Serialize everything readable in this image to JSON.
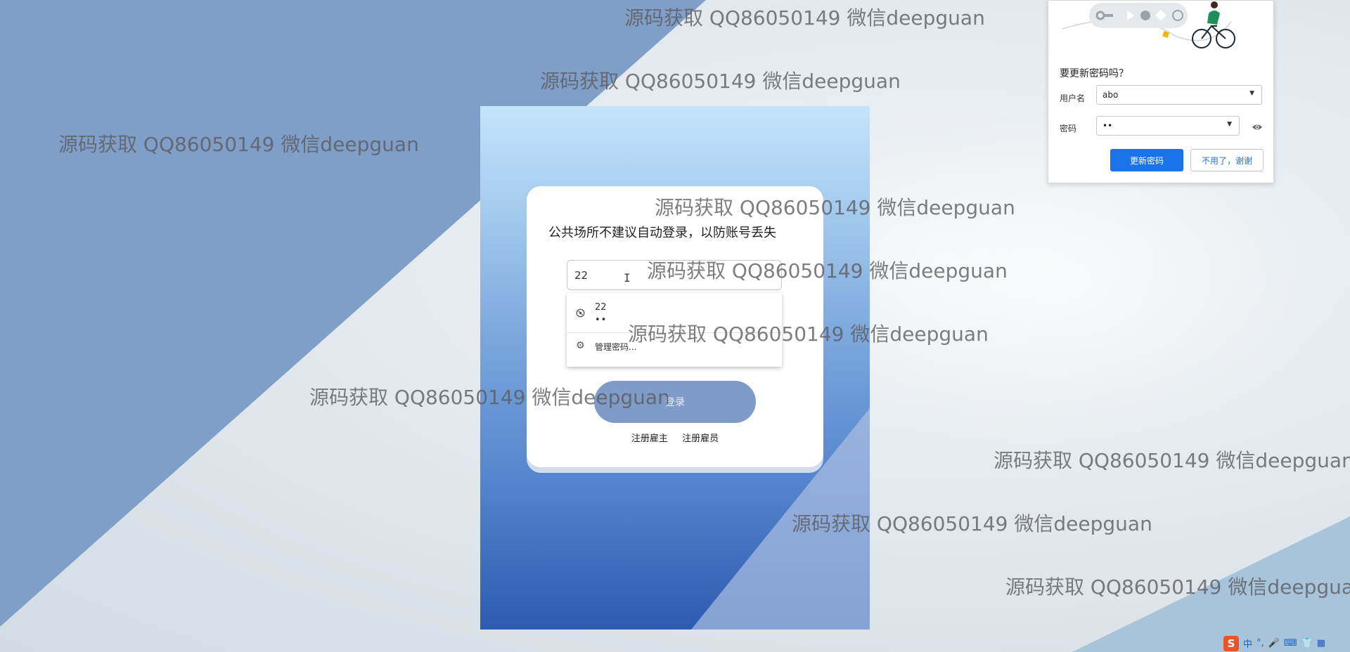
{
  "login": {
    "notice": "公共场所不建议自动登录，以防账号丢失",
    "username_value": "22",
    "autofill_username": "22",
    "autofill_password": "••",
    "manage_passwords": "管理密码...",
    "login_button": "登录",
    "register_employer": "注册雇主",
    "register_employee": "注册雇员"
  },
  "password_prompt": {
    "title": "要更新密码吗？",
    "username_label": "用户名",
    "username_value": "abo",
    "password_label": "密码",
    "password_value": "••",
    "update_button": "更新密码",
    "dismiss_button": "不用了，谢谢"
  },
  "watermark": {
    "text": "源码获取 QQ86050149 微信deepguan"
  },
  "tray": {
    "ime_logo": "S",
    "ime_mode": "中",
    "punct": "°,",
    "mic": "🎤",
    "keyboard": "⌨",
    "skin": "👕",
    "grid": "▦"
  },
  "colors": {
    "accent": "#1a73e8",
    "login_button": "#7f9bc8",
    "background_blue": "#7f9fc8"
  }
}
